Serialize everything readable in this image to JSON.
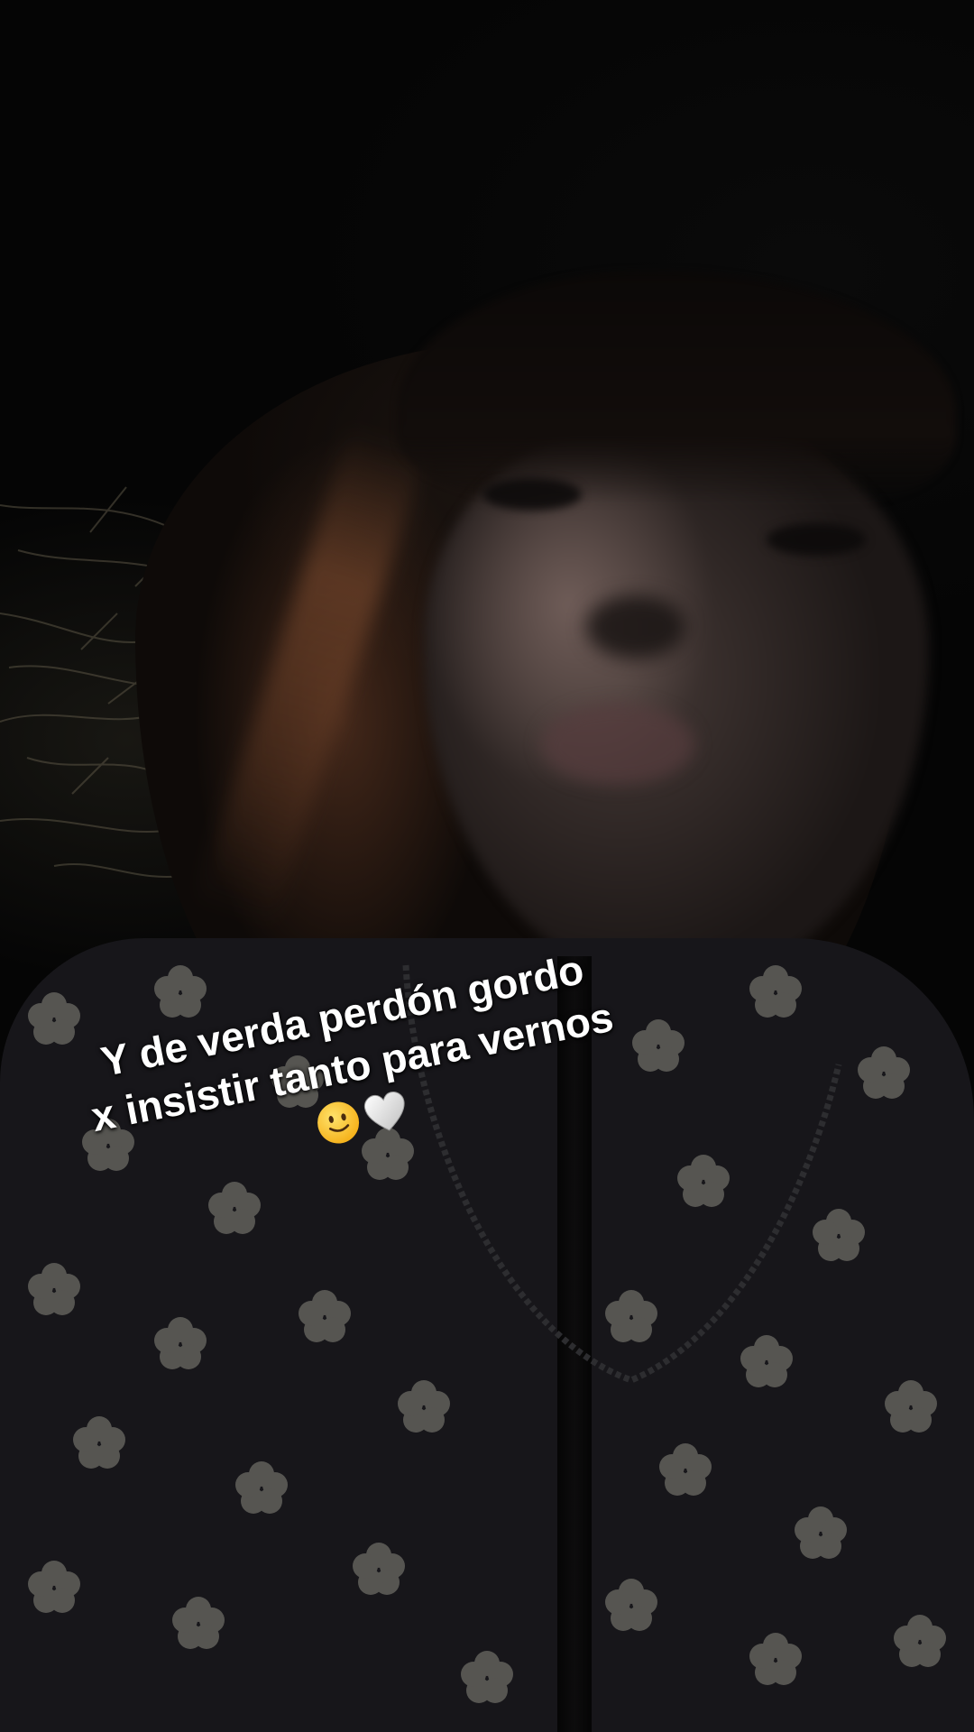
{
  "story": {
    "caption": {
      "line1": "Y de verda perdón gordo",
      "line2": "x insistir tanto para vernos",
      "emojis": [
        "slightly-smiling-face-icon",
        "white-heart-icon"
      ]
    }
  },
  "colors": {
    "caption_text": "#ffffff",
    "background": "#040404"
  }
}
